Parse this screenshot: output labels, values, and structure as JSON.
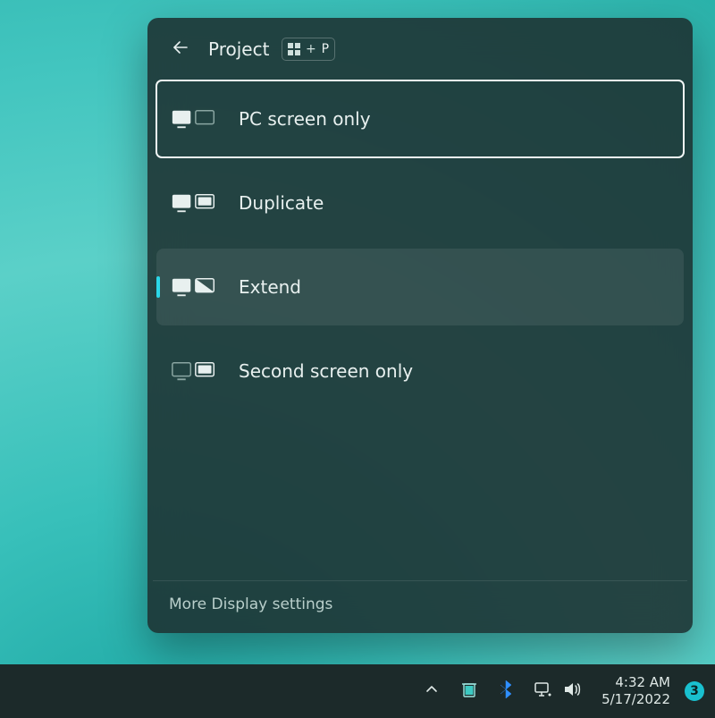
{
  "flyout": {
    "title": "Project",
    "shortcut": {
      "key": "P"
    },
    "options": [
      {
        "id": "pc-only",
        "label": "PC screen only",
        "selected": true,
        "hovered": false
      },
      {
        "id": "duplicate",
        "label": "Duplicate",
        "selected": false,
        "hovered": false
      },
      {
        "id": "extend",
        "label": "Extend",
        "selected": false,
        "hovered": true
      },
      {
        "id": "second-only",
        "label": "Second screen only",
        "selected": false,
        "hovered": false
      }
    ],
    "more_link": "More Display settings"
  },
  "taskbar": {
    "time": "4:32 AM",
    "date": "5/17/2022",
    "notification_count": "3"
  }
}
